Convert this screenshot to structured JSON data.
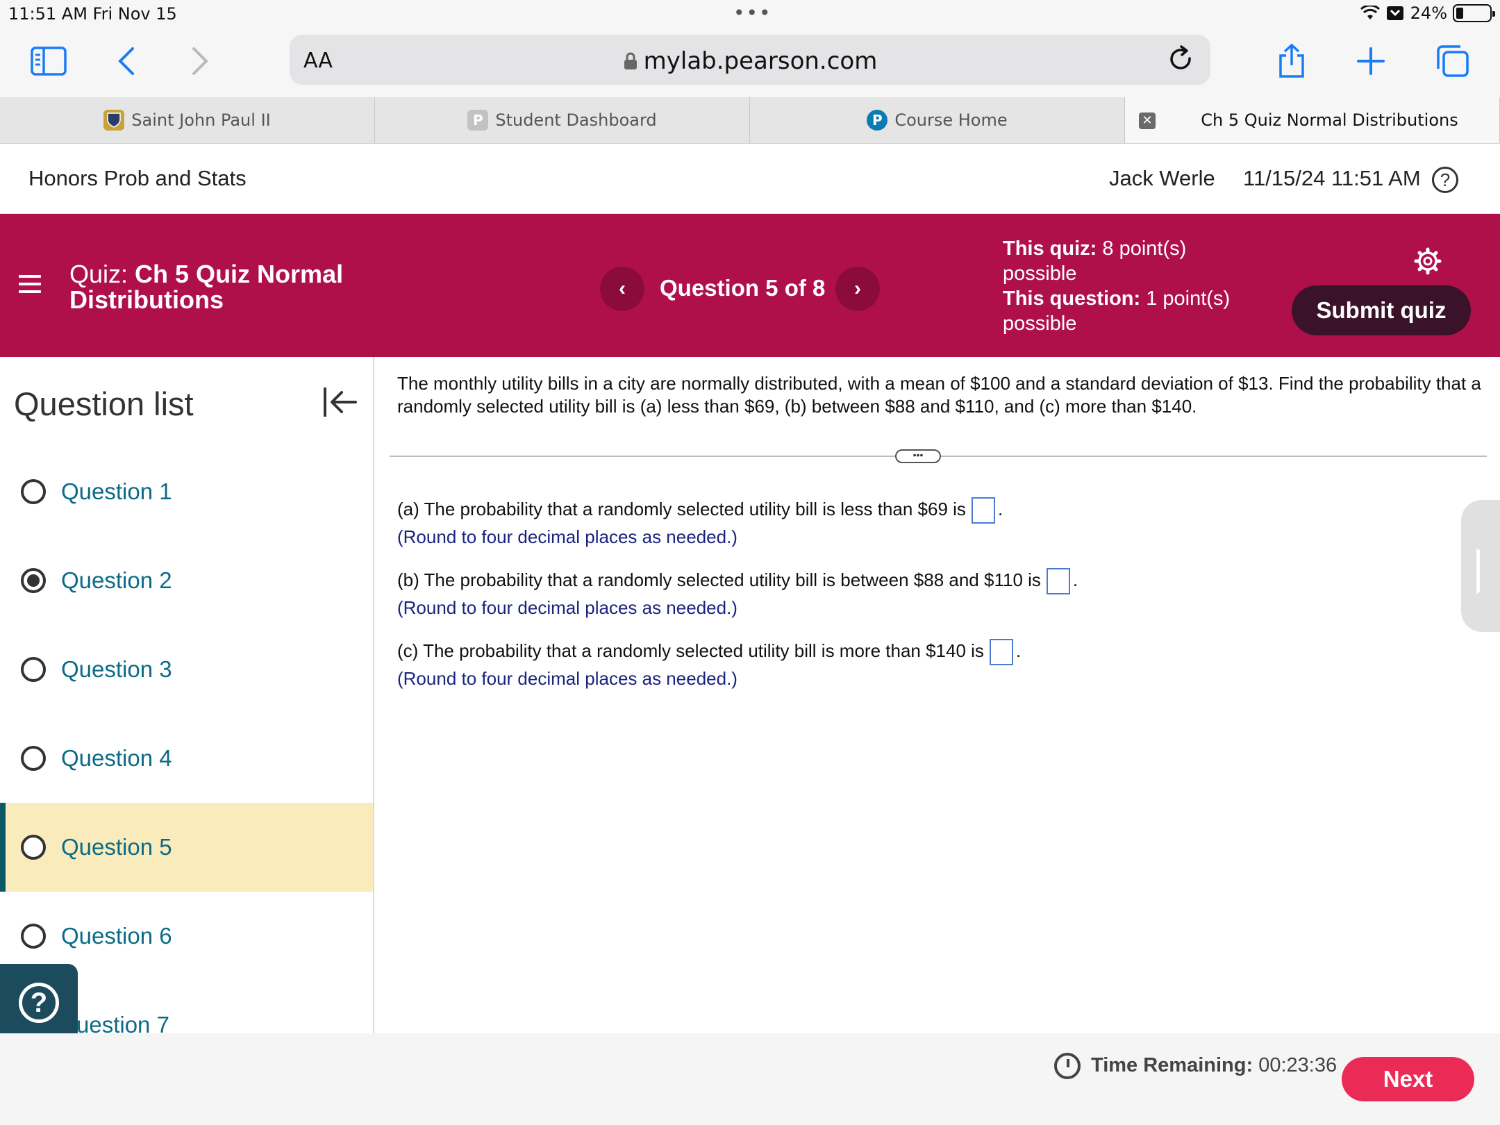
{
  "status_bar": {
    "time": "11:51 AM   Fri Nov 15",
    "dots": "•••",
    "battery": "24%"
  },
  "browser": {
    "text_size_label": "AA",
    "url": "mylab.pearson.com"
  },
  "tabs": [
    {
      "label": "Saint John Paul II",
      "icon": "shield-icon",
      "icon_color": "#c9a23a"
    },
    {
      "label": "Student Dashboard",
      "icon": "p-icon",
      "icon_color": "#bdbdbd",
      "icon_text": "P"
    },
    {
      "label": "Course Home",
      "icon": "pearson-icon",
      "icon_color": "#0c7bb3",
      "icon_text": "P"
    },
    {
      "label": "Ch 5 Quiz Normal Distributions",
      "active": true
    }
  ],
  "header": {
    "course": "Honors Prob and Stats",
    "user": "Jack Werle",
    "datetime": "11/15/24 11:51 AM"
  },
  "banner": {
    "quiz_prefix": "Quiz:",
    "quiz_name": "Ch 5 Quiz Normal Distributions",
    "question_of": "Question 5 of 8",
    "quiz_points_label": "This quiz:",
    "quiz_points": "8 point(s) possible",
    "question_points_label": "This question:",
    "question_points": "1 point(s) possible",
    "submit_label": "Submit quiz",
    "color": "#b01049"
  },
  "sidebar": {
    "title": "Question list",
    "items": [
      {
        "label": "Question 1",
        "state": "empty"
      },
      {
        "label": "Question 2",
        "state": "answered"
      },
      {
        "label": "Question 3",
        "state": "empty"
      },
      {
        "label": "Question 4",
        "state": "empty"
      },
      {
        "label": "Question 5",
        "state": "current"
      },
      {
        "label": "Question 6",
        "state": "empty"
      },
      {
        "label": "uestion 7",
        "state": "empty"
      }
    ]
  },
  "question": {
    "stem": "The monthly utility bills in a city are normally distributed, with a mean of $100 and a standard deviation of $13. Find the probability that a randomly selected utility bill is (a) less than $69, (b) between $88 and $110, and (c) more than $140.",
    "expander": "•••",
    "parts": [
      {
        "text": "(a) The probability that a randomly selected utility bill is less than $69 is",
        "hint": "(Round to four decimal places as needed.)"
      },
      {
        "text": "(b) The probability that a randomly selected utility bill is between $88 and $110 is",
        "hint": "(Round to four decimal places as needed.)"
      },
      {
        "text": "(c) The probability that a randomly selected utility bill is more than $140 is",
        "hint": "(Round to four decimal places as needed.)"
      }
    ],
    "period": "."
  },
  "footer": {
    "time_label": "Time Remaining:",
    "time_value": "00:23:36",
    "next_label": "Next"
  }
}
